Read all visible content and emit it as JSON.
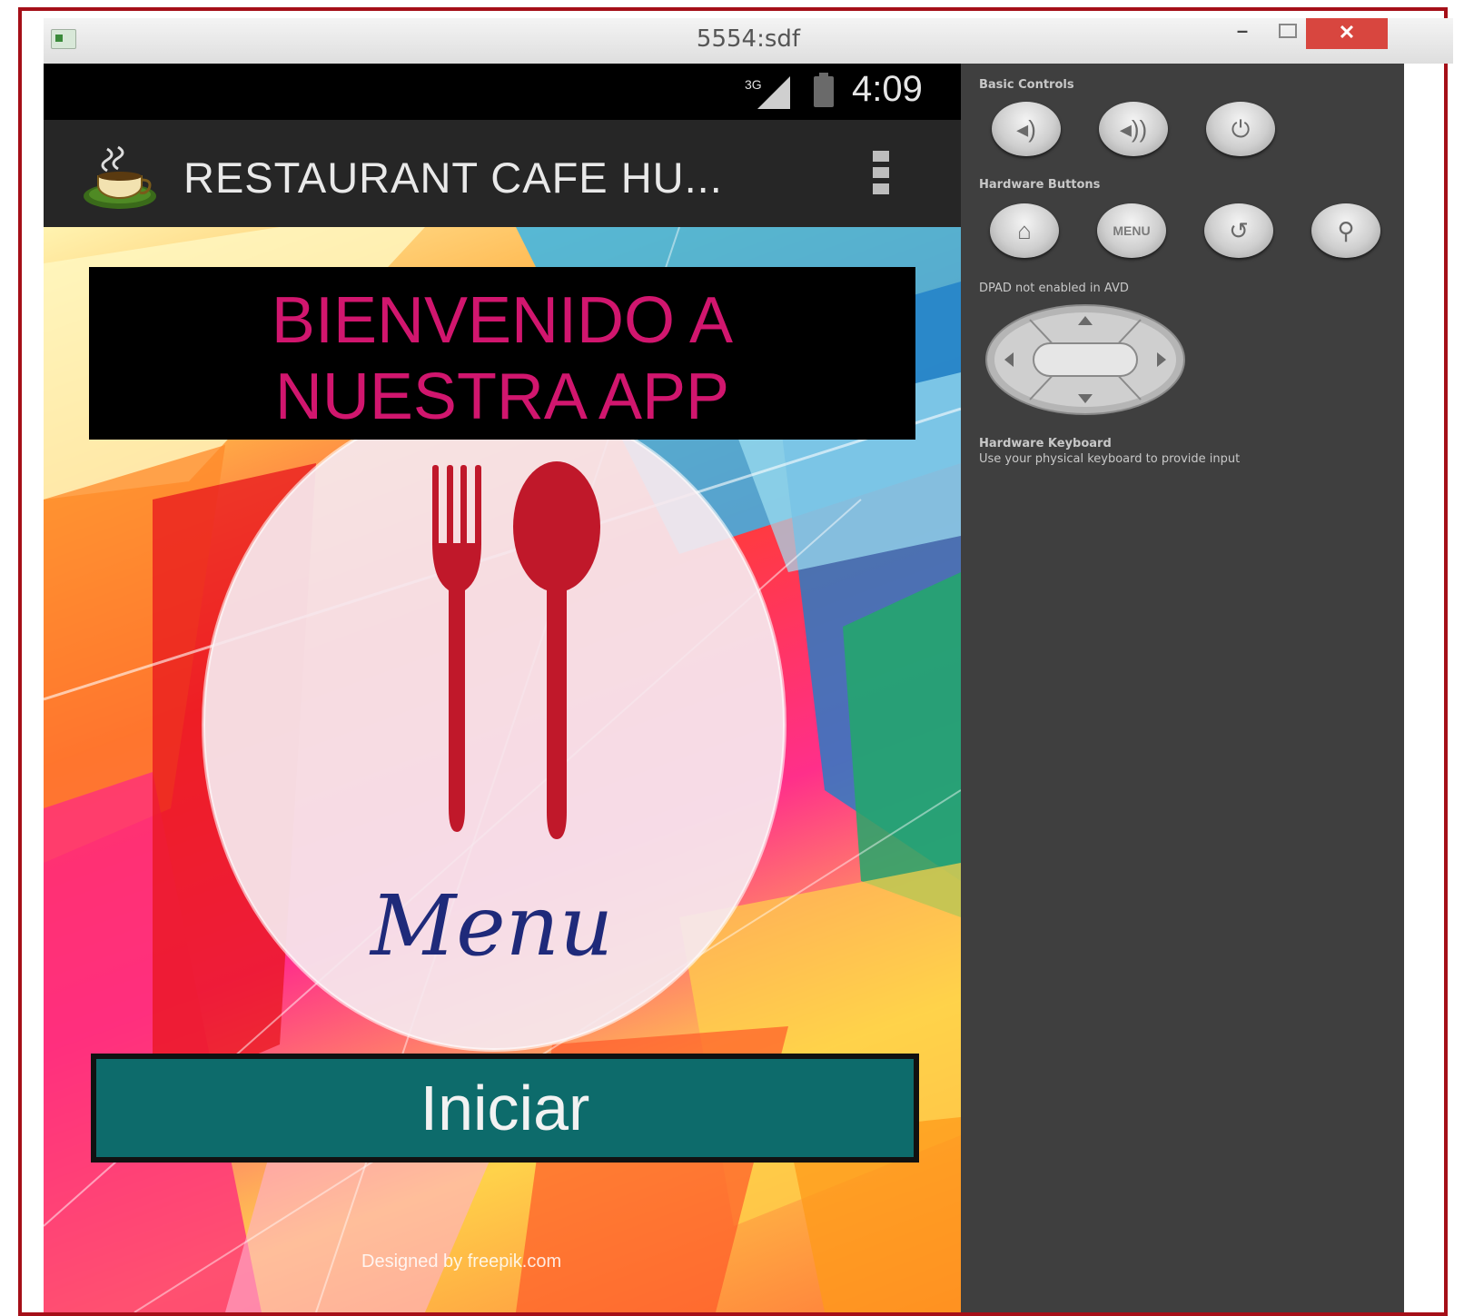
{
  "window": {
    "title": "5554:sdf",
    "minimize_glyph": "–",
    "close_glyph": "✕"
  },
  "status_bar": {
    "network": "3G",
    "time": "4:09"
  },
  "action_bar": {
    "app_title": "RESTAURANT CAFE HU...",
    "app_icon": "coffee-cup-icon",
    "overflow_icon": "overflow-menu-icon"
  },
  "main": {
    "welcome_line1": "BIENVENIDO A",
    "welcome_line2": "NUESTRA APP",
    "menu_logo_text": "Menu",
    "start_button": "Iniciar",
    "credit": "Designed by freepik.com"
  },
  "controls": {
    "basic_controls_label": "Basic Controls",
    "hardware_buttons_label": "Hardware Buttons",
    "dpad_label": "DPAD not enabled in AVD",
    "keyboard_label": "Hardware Keyboard",
    "keyboard_hint": "Use your physical keyboard to provide input",
    "menu_button_label": "MENU",
    "buttons": {
      "volume_down": "volume-down-icon",
      "volume_up": "volume-up-icon",
      "power": "power-icon",
      "home": "home-icon",
      "back": "back-icon",
      "search": "search-icon"
    }
  },
  "colors": {
    "welcome_text": "#d1166e",
    "start_button_bg": "#0d6b6b",
    "cutlery": "#c0182a",
    "menu_text": "#1f2a7a",
    "window_border": "#a50f18",
    "close_button": "#d8463f"
  }
}
